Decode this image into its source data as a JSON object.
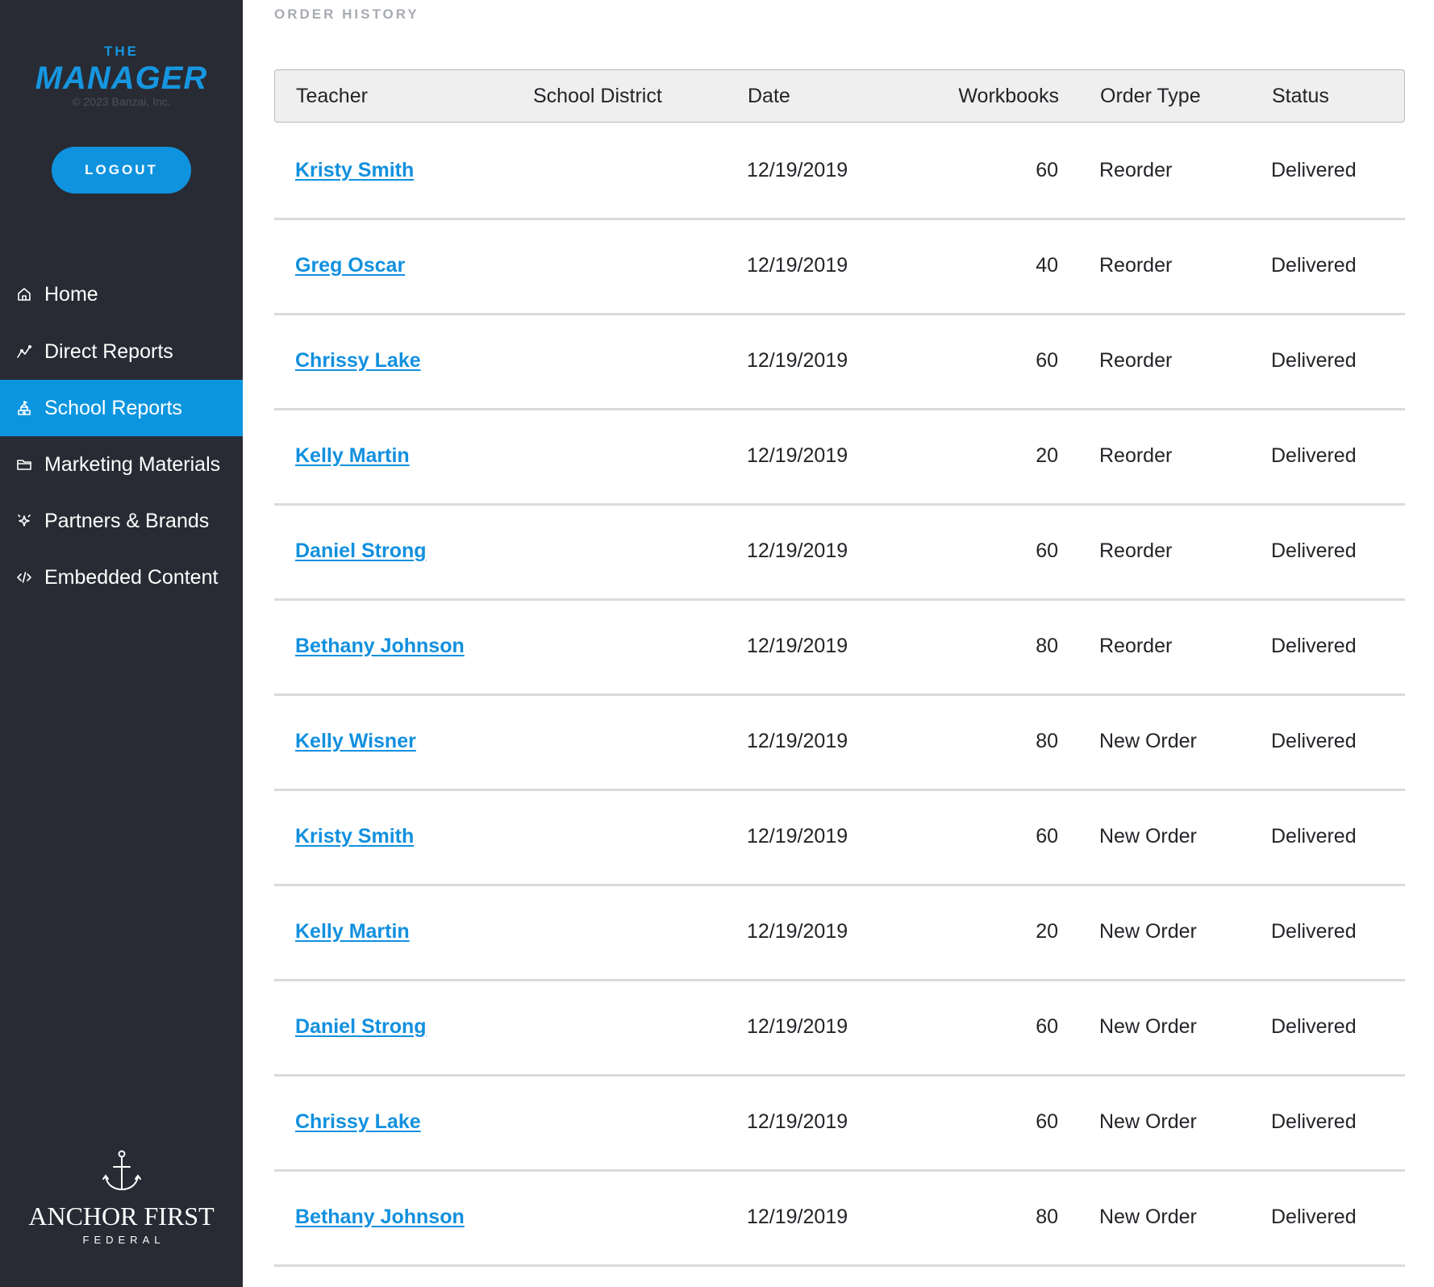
{
  "sidebar": {
    "brand": {
      "the": "THE",
      "name": "MANAGER",
      "copyright": "© 2023 Banzai, Inc."
    },
    "logout_label": "LOGOUT",
    "items": [
      {
        "label": "Home",
        "icon": "home-icon",
        "active": false
      },
      {
        "label": "Direct Reports",
        "icon": "trend-line-icon",
        "active": false
      },
      {
        "label": "School Reports",
        "icon": "school-icon",
        "active": true
      },
      {
        "label": "Marketing Materials",
        "icon": "folder-icon",
        "active": false
      },
      {
        "label": "Partners & Brands",
        "icon": "sparkle-icon",
        "active": false
      },
      {
        "label": "Embedded Content",
        "icon": "code-icon",
        "active": false
      }
    ],
    "partner": {
      "name": "ANCHOR FIRST",
      "sub": "FEDERAL",
      "icon": "anchor-icon"
    }
  },
  "main": {
    "section_title": "ORDER HISTORY",
    "columns": [
      "Teacher",
      "School District",
      "Date",
      "Workbooks",
      "Order Type",
      "Status"
    ],
    "rows": [
      {
        "teacher": "Kristy Smith",
        "district": "",
        "date": "12/19/2019",
        "workbooks": "60",
        "order_type": "Reorder",
        "status": "Delivered"
      },
      {
        "teacher": "Greg Oscar",
        "district": "",
        "date": "12/19/2019",
        "workbooks": "40",
        "order_type": "Reorder",
        "status": "Delivered"
      },
      {
        "teacher": "Chrissy Lake",
        "district": "",
        "date": "12/19/2019",
        "workbooks": "60",
        "order_type": "Reorder",
        "status": "Delivered"
      },
      {
        "teacher": "Kelly Martin",
        "district": "",
        "date": "12/19/2019",
        "workbooks": "20",
        "order_type": "Reorder",
        "status": "Delivered"
      },
      {
        "teacher": "Daniel Strong",
        "district": "",
        "date": "12/19/2019",
        "workbooks": "60",
        "order_type": "Reorder",
        "status": "Delivered"
      },
      {
        "teacher": "Bethany Johnson",
        "district": "",
        "date": "12/19/2019",
        "workbooks": "80",
        "order_type": "Reorder",
        "status": "Delivered"
      },
      {
        "teacher": "Kelly Wisner",
        "district": "",
        "date": "12/19/2019",
        "workbooks": "80",
        "order_type": "New Order",
        "status": "Delivered"
      },
      {
        "teacher": "Kristy Smith",
        "district": "",
        "date": "12/19/2019",
        "workbooks": "60",
        "order_type": "New Order",
        "status": "Delivered"
      },
      {
        "teacher": "Kelly Martin",
        "district": "",
        "date": "12/19/2019",
        "workbooks": "20",
        "order_type": "New Order",
        "status": "Delivered"
      },
      {
        "teacher": "Daniel Strong",
        "district": "",
        "date": "12/19/2019",
        "workbooks": "60",
        "order_type": "New Order",
        "status": "Delivered"
      },
      {
        "teacher": "Chrissy Lake",
        "district": "",
        "date": "12/19/2019",
        "workbooks": "60",
        "order_type": "New Order",
        "status": "Delivered"
      },
      {
        "teacher": "Bethany Johnson",
        "district": "",
        "date": "12/19/2019",
        "workbooks": "80",
        "order_type": "New Order",
        "status": "Delivered"
      }
    ]
  },
  "colors": {
    "sidebar_bg": "#282b33",
    "accent": "#0c95df",
    "link": "#1290df",
    "header_bg": "#efefef",
    "row_divider": "#d9dadc",
    "section_title": "#a8abb2"
  }
}
